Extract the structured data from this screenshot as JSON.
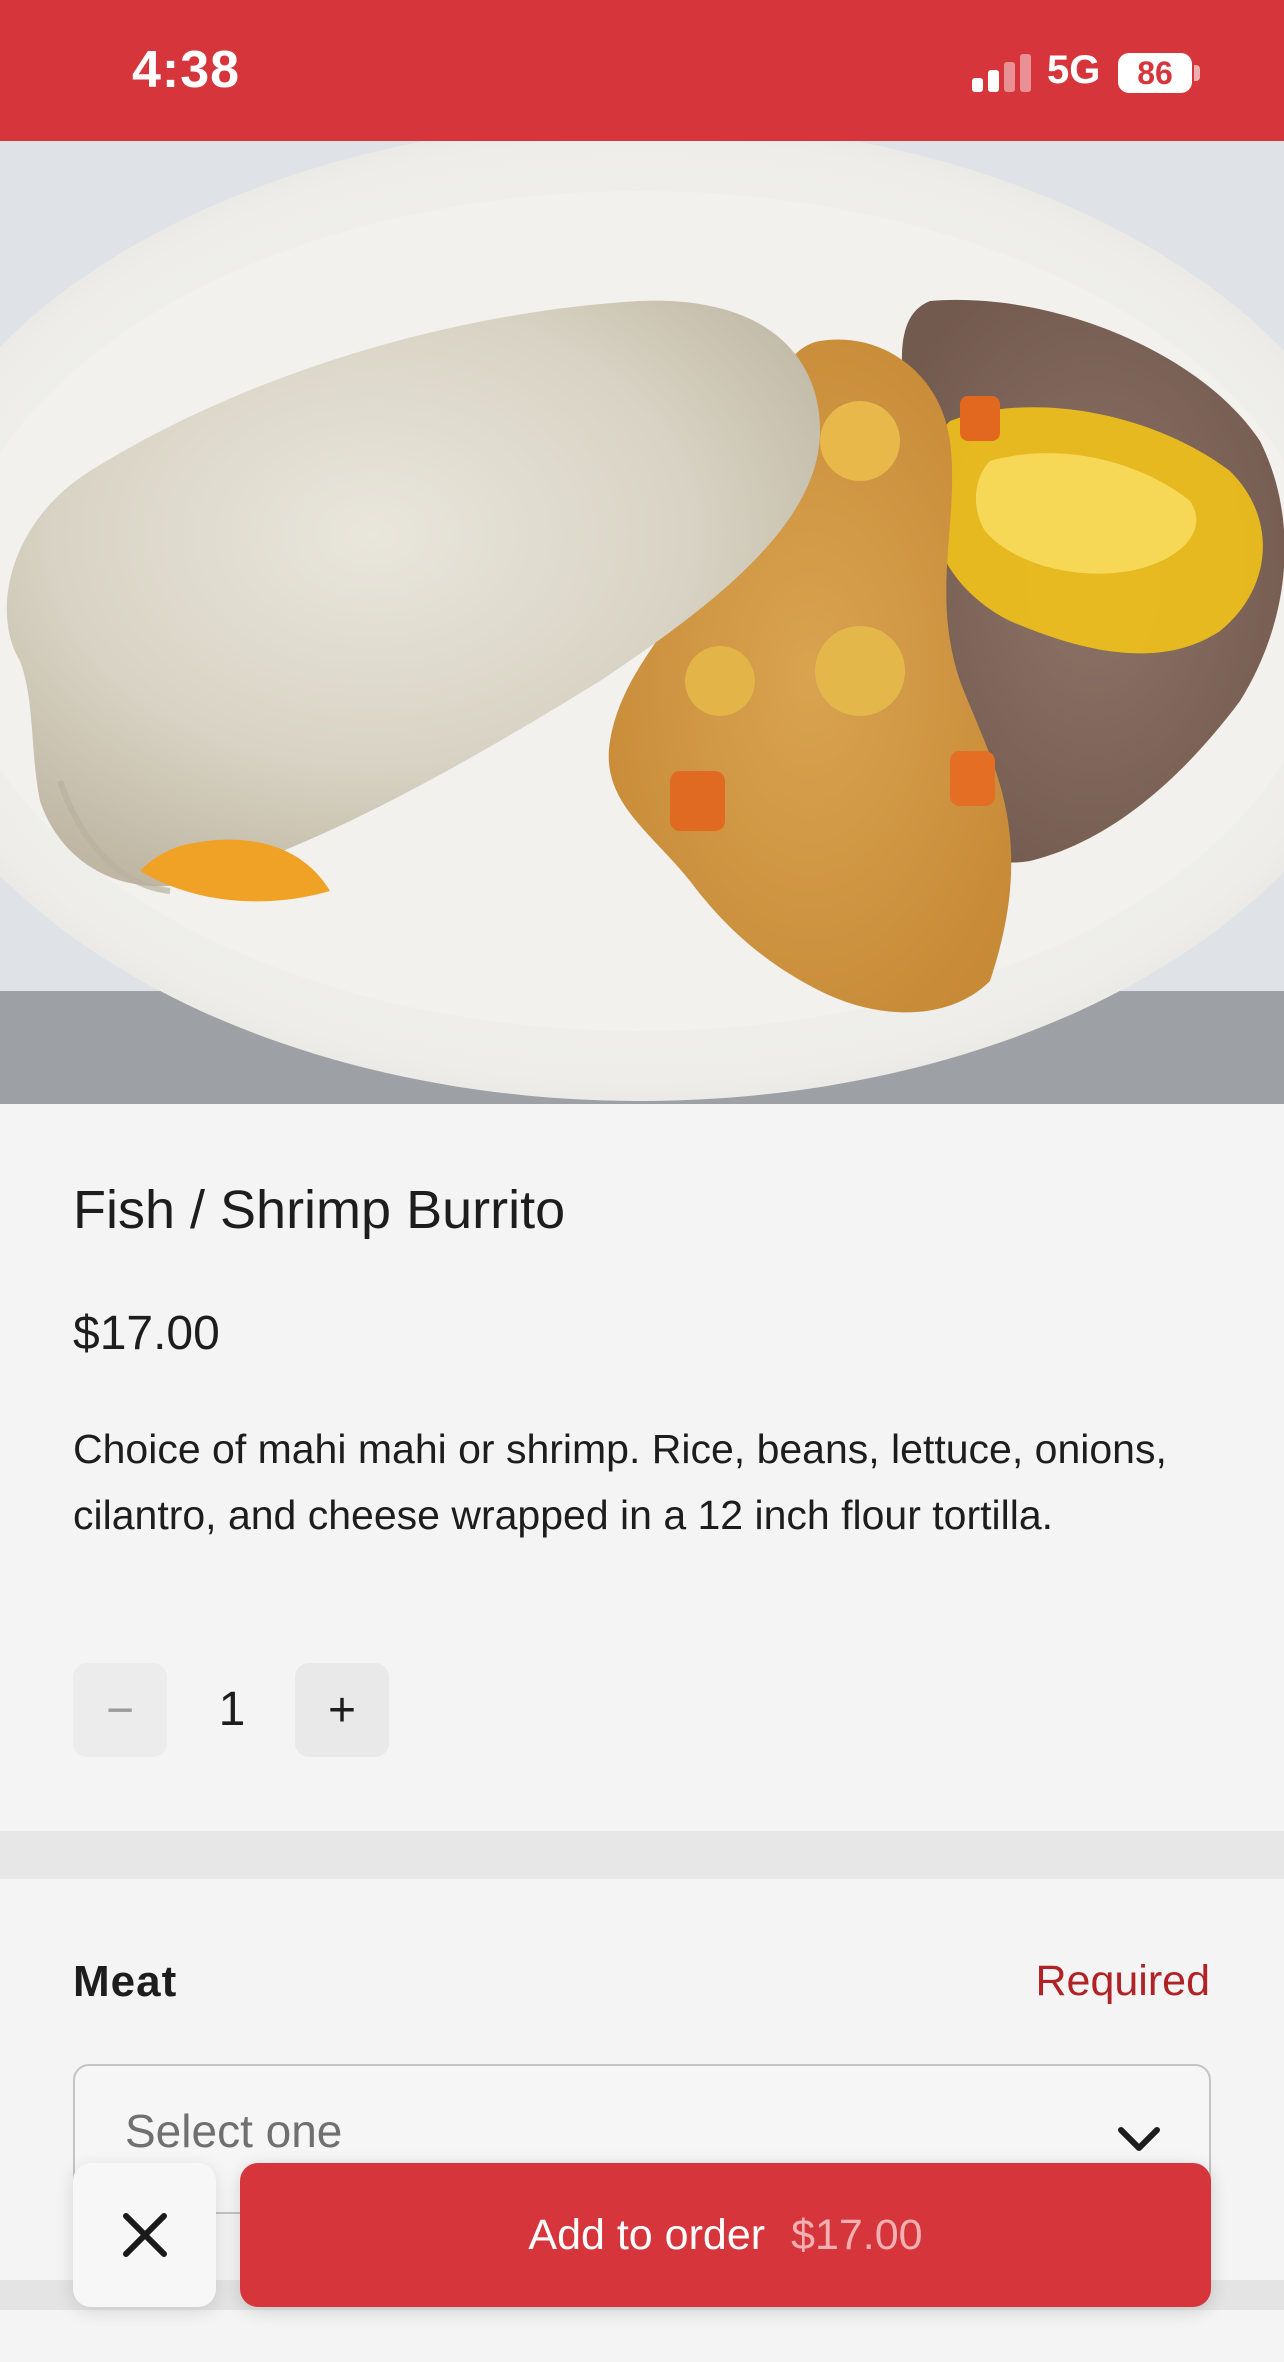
{
  "status_bar": {
    "time": "4:38",
    "network": "5G",
    "battery": "86",
    "icons": [
      "signal-icon",
      "battery-icon"
    ],
    "background": "#d6363b"
  },
  "hero": {
    "image": "burrito-plate-image"
  },
  "item": {
    "title": "Fish / Shrimp Burrito",
    "price": "$17.00",
    "description": "Choice of mahi mahi or shrimp. Rice, beans, lettuce, onions, cilantro, and cheese wrapped in a 12 inch flour tortilla."
  },
  "quantity": {
    "minus": "−",
    "value": "1",
    "plus": "+"
  },
  "options": {
    "label": "Meat",
    "required": "Required",
    "placeholder": "Select one"
  },
  "actions": {
    "close_icon": "close-icon",
    "add_label": "Add to order",
    "add_price": "$17.00",
    "accent": "#d6363b"
  }
}
